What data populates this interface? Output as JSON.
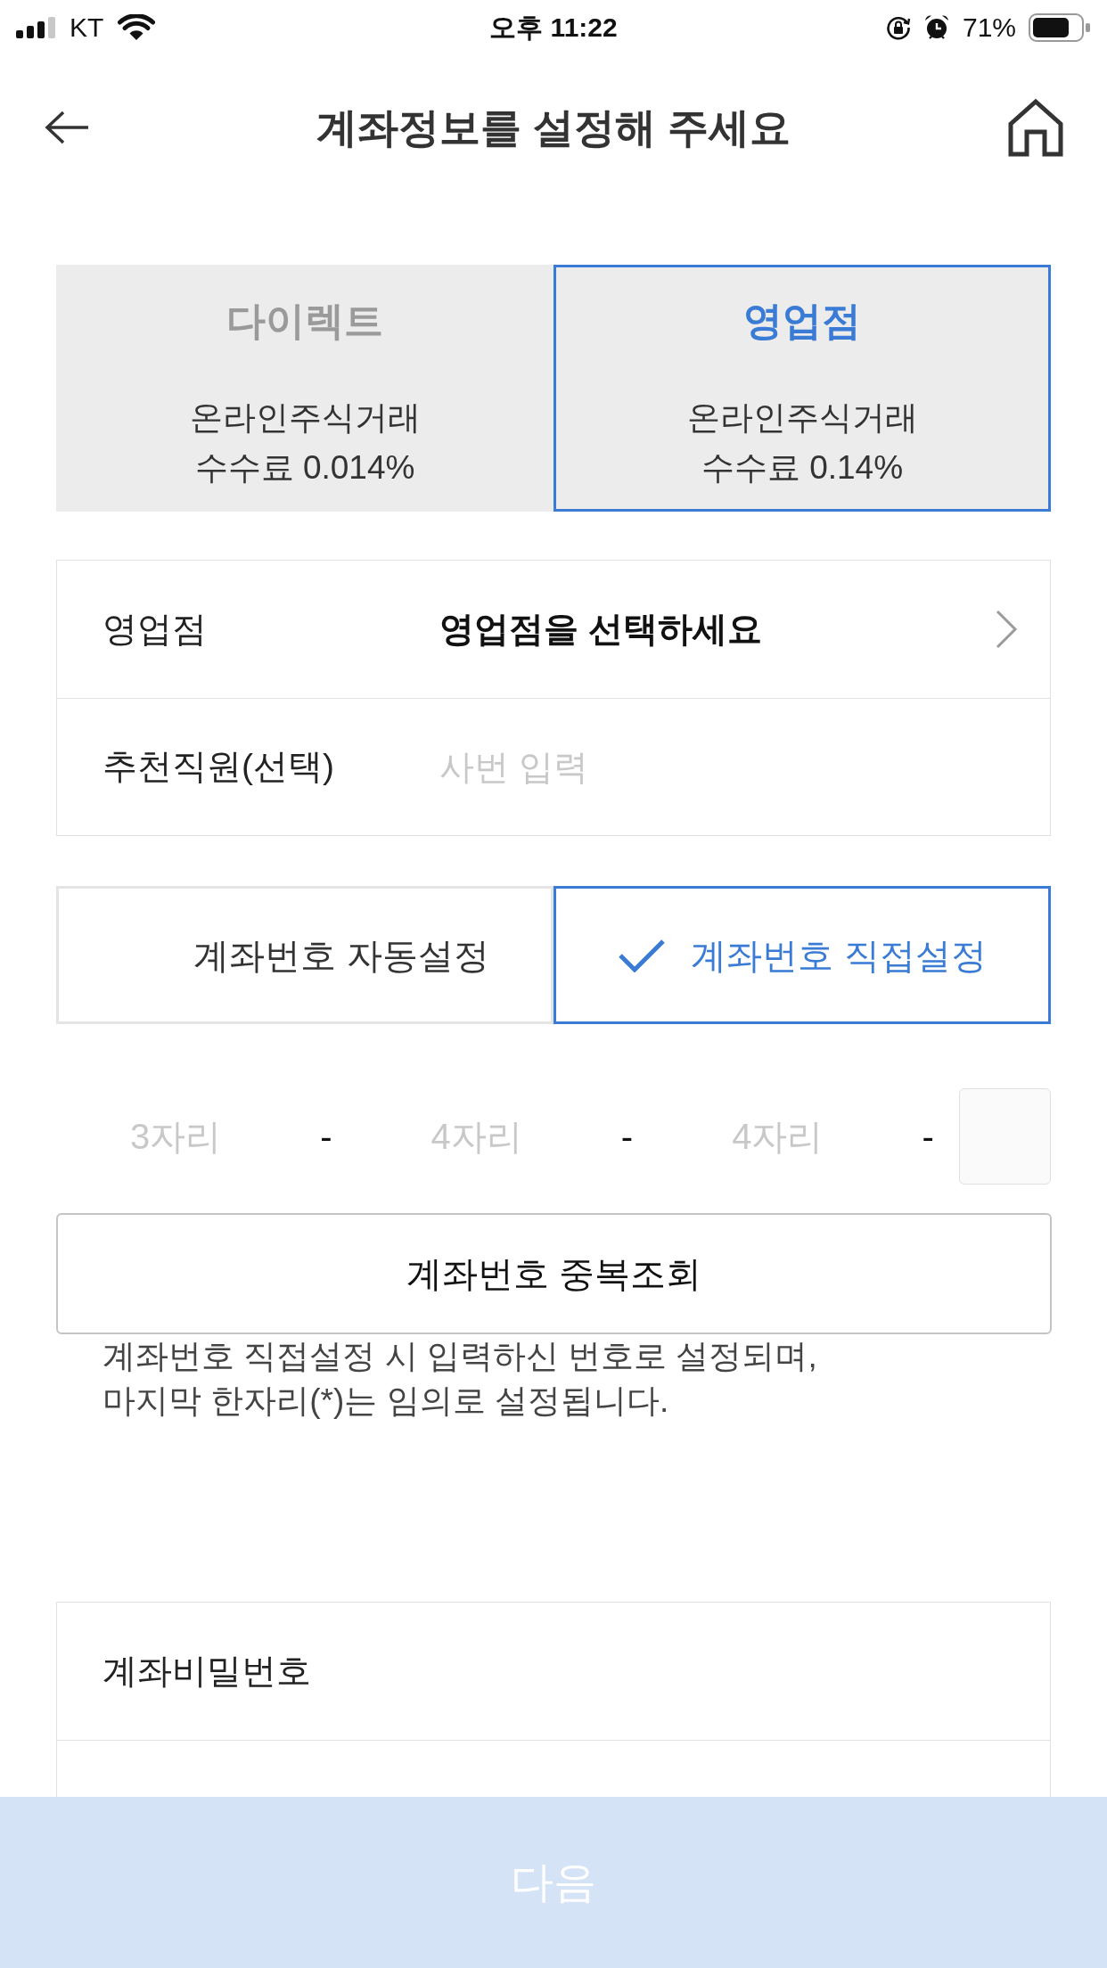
{
  "status_bar": {
    "carrier": "KT",
    "time": "오후 11:22",
    "battery": "71%"
  },
  "header": {
    "title": "계좌정보를 설정해 주세요"
  },
  "account_types": [
    {
      "title": "다이렉트",
      "lines": [
        "온라인주식거래",
        "수수료 0.014%"
      ],
      "selected": false
    },
    {
      "title": "영업점",
      "lines": [
        "온라인주식거래",
        "수수료 0.14%"
      ],
      "selected": true
    }
  ],
  "branch_form": [
    {
      "kind": "select",
      "label": "영업점",
      "value": "영업점을 선택하세요"
    },
    {
      "kind": "input",
      "label": "추천직원(선택)",
      "placeholder": "사번 입력"
    }
  ],
  "number_modes": [
    {
      "label": "계좌번호 자동설정",
      "selected": false
    },
    {
      "label": "계좌번호 직접설정",
      "selected": true
    }
  ],
  "account_number": {
    "segments": [
      {
        "placeholder": "3자리",
        "separator": "-"
      },
      {
        "placeholder": "4자리",
        "separator": "-"
      },
      {
        "placeholder": "4자리",
        "separator": "-"
      }
    ],
    "last_digit": {
      "disabled": true
    }
  },
  "duplicate_check_button": {
    "label": "계좌번호 중복조회"
  },
  "notice": "계좌번호 직접설정 시 입력하신 번호로 설정되며,\n마지막 한자리(*)는 임의로 설정됩니다.",
  "password_form": [
    {
      "label": "계좌비밀번호"
    }
  ],
  "next_button": {
    "label": "다음",
    "disabled": true
  }
}
